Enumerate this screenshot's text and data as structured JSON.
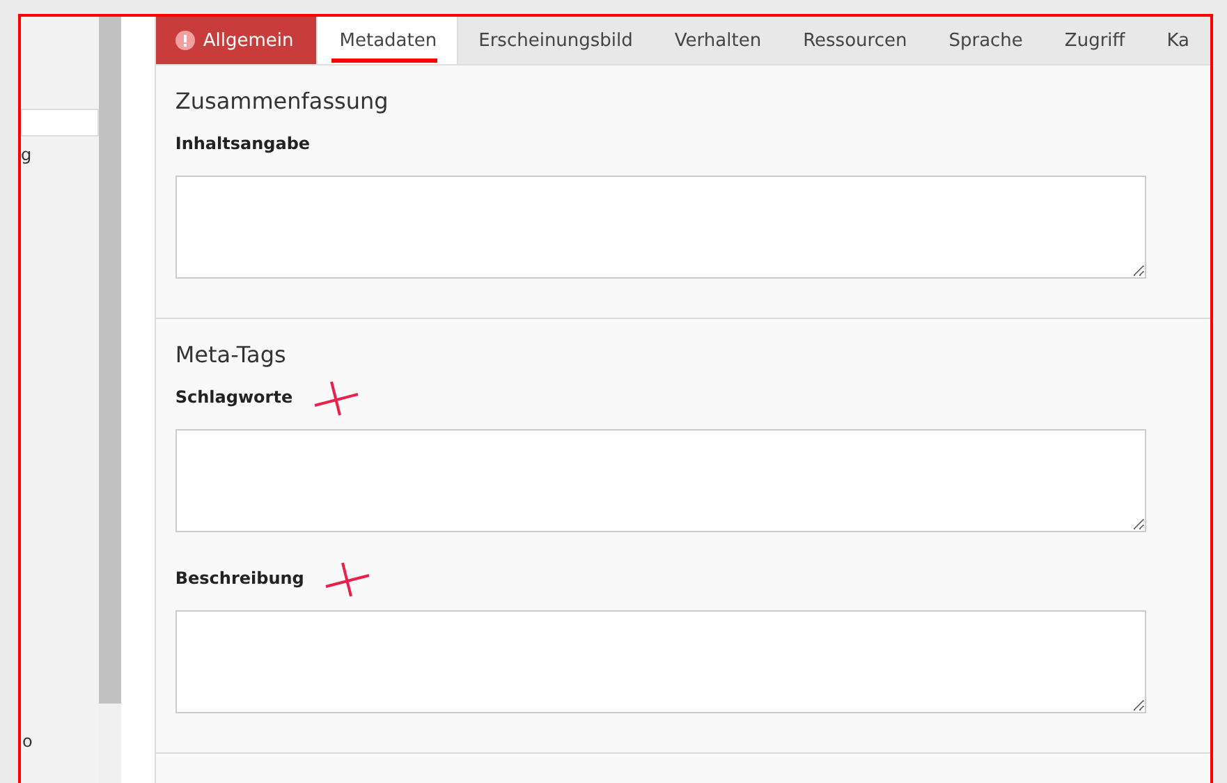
{
  "sidebar": {
    "items": [
      {
        "label": "g"
      },
      {
        "label": "o"
      }
    ]
  },
  "tabs": [
    {
      "label": "Allgemein",
      "error": true,
      "selected": false
    },
    {
      "label": "Metadaten",
      "error": false,
      "selected": true
    },
    {
      "label": "Erscheinungsbild",
      "error": false,
      "selected": false
    },
    {
      "label": "Verhalten",
      "error": false,
      "selected": false
    },
    {
      "label": "Ressourcen",
      "error": false,
      "selected": false
    },
    {
      "label": "Sprache",
      "error": false,
      "selected": false
    },
    {
      "label": "Zugriff",
      "error": false,
      "selected": false
    },
    {
      "label": "Ka",
      "error": false,
      "selected": false
    }
  ],
  "sections": [
    {
      "title": "Zusammenfassung",
      "fields": [
        {
          "label": "Inhaltsangabe",
          "marked": false
        }
      ]
    },
    {
      "title": "Meta-Tags",
      "fields": [
        {
          "label": "Schlagworte",
          "marked": true
        },
        {
          "label": "Beschreibung",
          "marked": true
        }
      ]
    }
  ]
}
